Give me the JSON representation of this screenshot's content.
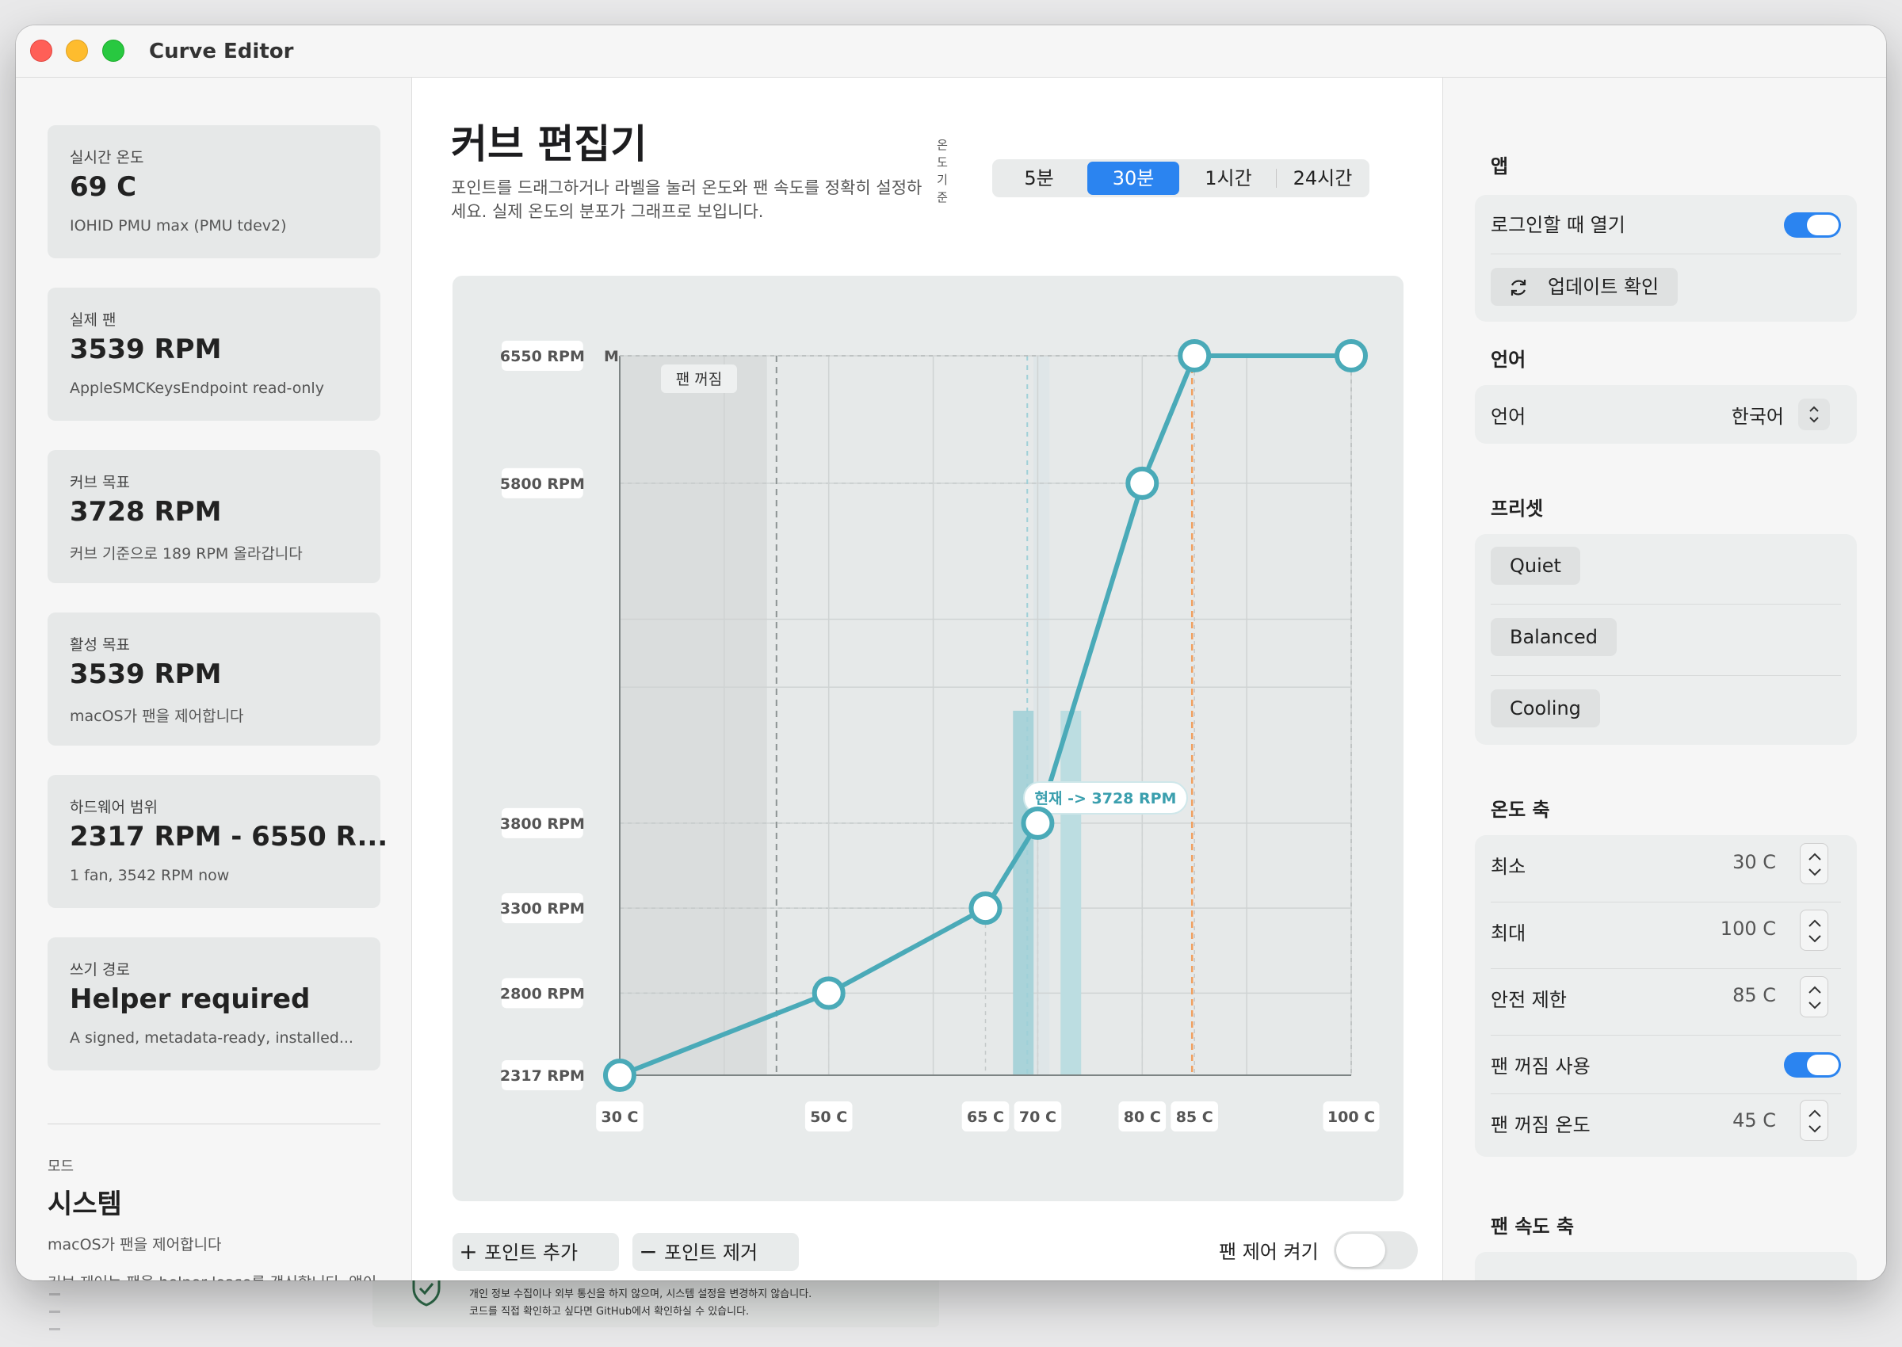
{
  "window": {
    "title": "Curve Editor"
  },
  "sidebar": {
    "cards": [
      {
        "label": "실시간 온도",
        "value": "69 C",
        "sub": "IOHID PMU max (PMU tdev2)"
      },
      {
        "label": "실제 팬",
        "value": "3539 RPM",
        "sub": "AppleSMCKeysEndpoint read-only"
      },
      {
        "label": "커브 목표",
        "value": "3728 RPM",
        "sub": "커브 기준으로 189 RPM 올라갑니다"
      },
      {
        "label": "활성 목표",
        "value": "3539 RPM",
        "sub": "macOS가 팬을 제어합니다"
      },
      {
        "label": "하드웨어 범위",
        "value": "2317 RPM - 6550 R...",
        "sub": "1 fan, 3542 RPM now"
      },
      {
        "label": "쓰기 경로",
        "value": "Helper required",
        "sub": "A signed, metadata-ready, installed..."
      }
    ],
    "mode_label": "모드",
    "mode_value": "시스템",
    "mode_sub": "macOS가 팬을 제어합니다",
    "cut_text": "커브 제어는 팬을 helper lease를 갱신합니다. 앱이"
  },
  "main": {
    "title": "커브 편집기",
    "description": "포인트를 드래그하거나 라벨을 눌러 온도와 팬 속도를 정확히 설정하세요. 실제 온도의 분포가 그래프로 보입니다.",
    "vertical_label": "온도기준",
    "time_ranges": [
      "5분",
      "30분",
      "1시간",
      "24시간"
    ],
    "time_range_selected": "30분",
    "add_point": "포인트 추가",
    "remove_point": "포인트 제거",
    "fan_control_label": "팬 제어 켜기",
    "fan_control_on": false,
    "add_icon": "plus-icon",
    "remove_icon": "minus-icon"
  },
  "chart_data": {
    "type": "line",
    "xlim": [
      30,
      100
    ],
    "ylim": [
      2317,
      6550
    ],
    "x_unit": "C",
    "y_unit": "RPM",
    "x_ticks": [
      "30 C",
      "50 C",
      "65 C",
      "70 C",
      "80 C",
      "85 C",
      "100 C"
    ],
    "y_ticks": [
      "6550 RPM",
      "5800 RPM",
      "3800 RPM",
      "3300 RPM",
      "2800 RPM",
      "2317 RPM"
    ],
    "points": [
      {
        "x": 30,
        "y": 2317
      },
      {
        "x": 50,
        "y": 2800
      },
      {
        "x": 65,
        "y": 3300
      },
      {
        "x": 70,
        "y": 3800
      },
      {
        "x": 80,
        "y": 5800
      },
      {
        "x": 85,
        "y": 6550
      },
      {
        "x": 100,
        "y": 6550
      }
    ],
    "fan_off_temp": 45,
    "fan_off_label": "팬 꺼짐",
    "safety_limit": 85,
    "current_temp": 69,
    "current_label": "현재 -> 3728 RPM",
    "max_marker": "M",
    "line_color": "#4aaab8",
    "safety_color": "#f0a060"
  },
  "settings": {
    "app": {
      "title": "앱",
      "login_open": "로그인할 때 열기",
      "login_open_on": true,
      "update_check": "업데이트 확인",
      "update_icon": "refresh-icon"
    },
    "language": {
      "title": "언어",
      "label": "언어",
      "value": "한국어"
    },
    "presets": {
      "title": "프리셋",
      "items": [
        "Quiet",
        "Balanced",
        "Cooling"
      ]
    },
    "temp_axis": {
      "title": "온도 축",
      "min_label": "최소",
      "min_value": "30 C",
      "max_label": "최대",
      "max_value": "100 C",
      "safety_label": "안전 제한",
      "safety_value": "85 C",
      "fan_off_label": "팬 꺼짐 사용",
      "fan_off_on": true,
      "fan_off_temp_label": "팬 꺼짐 온도",
      "fan_off_temp_value": "45 C"
    },
    "fan_axis": {
      "title": "팬 속도 축"
    }
  },
  "background": {
    "line1": "개인 정보 수집이나 외부 통신을 하지 않으며, 시스템 설정을 변경하지 않습니다.",
    "line2": "코드를 직접 확인하고 싶다면 GitHub에서 확인하실 수 있습니다."
  }
}
